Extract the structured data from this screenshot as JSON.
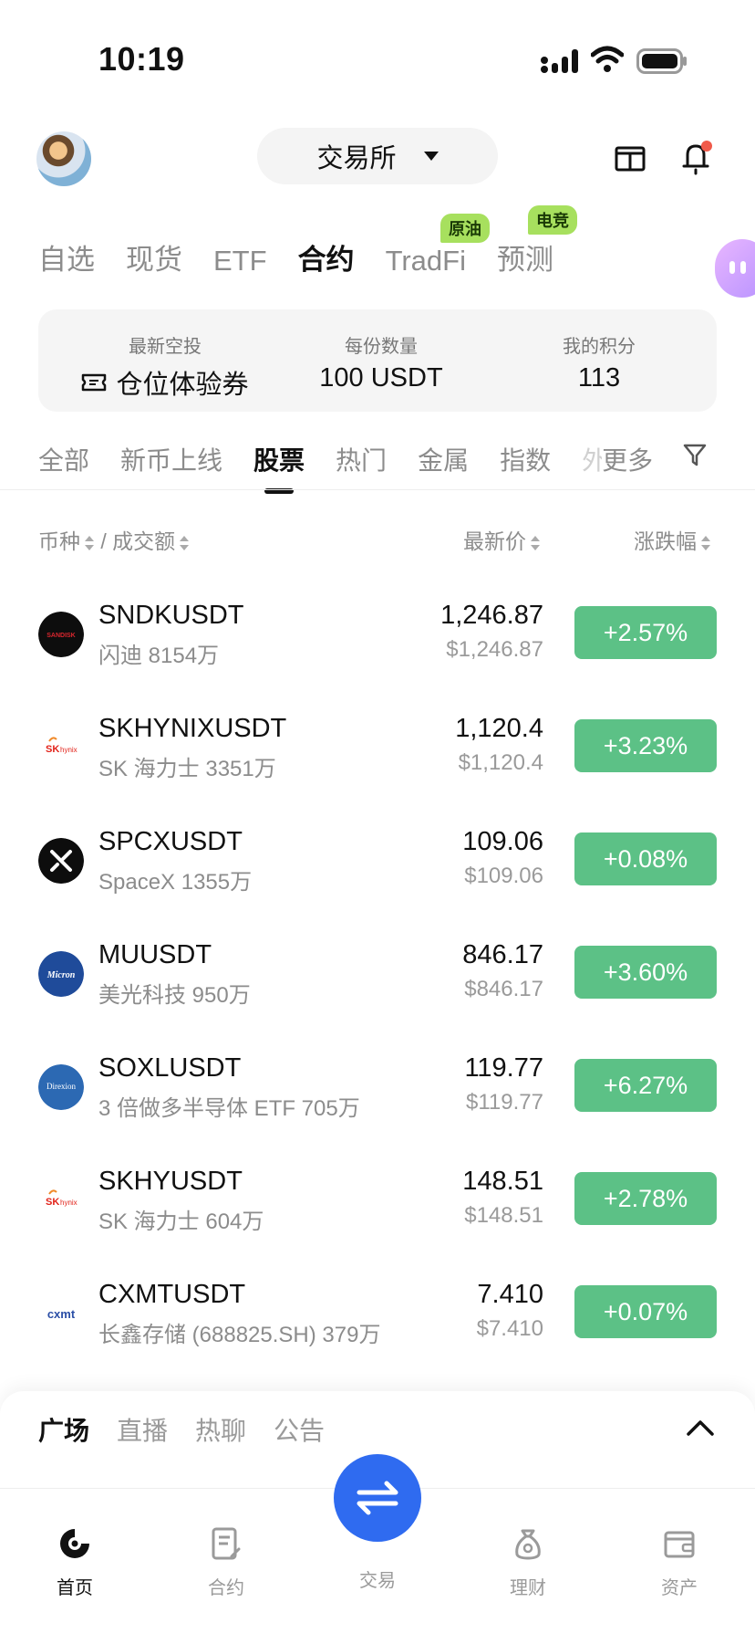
{
  "status_bar": {
    "time": "10:19"
  },
  "header": {
    "exchange_label": "交易所"
  },
  "category_tabs": [
    {
      "label": "自选",
      "active": false,
      "badge": ""
    },
    {
      "label": "现货",
      "active": false,
      "badge": ""
    },
    {
      "label": "ETF",
      "active": false,
      "badge": ""
    },
    {
      "label": "合约",
      "active": true,
      "badge": ""
    },
    {
      "label": "TradFi",
      "active": false,
      "badge": "原油"
    },
    {
      "label": "预测",
      "active": false,
      "badge": "电竞"
    }
  ],
  "airdrop": {
    "latest_label": "最新空投",
    "latest_value": "仓位体验券",
    "amount_label": "每份数量",
    "amount_value": "100 USDT",
    "points_label": "我的积分",
    "points_value": "113"
  },
  "sub_tabs": [
    {
      "label": "全部",
      "active": false
    },
    {
      "label": "新币上线",
      "active": false
    },
    {
      "label": "股票",
      "active": true
    },
    {
      "label": "热门",
      "active": false
    },
    {
      "label": "金属",
      "active": false
    },
    {
      "label": "指数",
      "active": false
    },
    {
      "label": "外",
      "active": false
    },
    {
      "label": "更多",
      "active": false
    }
  ],
  "list_header": {
    "coin": "币种",
    "separator": "/",
    "volume": "成交额",
    "price": "最新价",
    "change": "涨跌幅"
  },
  "rows": [
    {
      "symbol": "SNDKUSDT",
      "name": "闪迪 8154万",
      "price": "1,246.87",
      "price_usd": "$1,246.87",
      "change": "+2.57%",
      "logo": "sandisk-logo"
    },
    {
      "symbol": "SKHYNIXUSDT",
      "name": "SK 海力士 3351万",
      "price": "1,120.4",
      "price_usd": "$1,120.4",
      "change": "+3.23%",
      "logo": "skhynix-logo"
    },
    {
      "symbol": "SPCXUSDT",
      "name": "SpaceX 1355万",
      "price": "109.06",
      "price_usd": "$109.06",
      "change": "+0.08%",
      "logo": "spacex-logo"
    },
    {
      "symbol": "MUUSDT",
      "name": "美光科技 950万",
      "price": "846.17",
      "price_usd": "$846.17",
      "change": "+3.60%",
      "logo": "micron-logo"
    },
    {
      "symbol": "SOXLUSDT",
      "name": "3 倍做多半导体 ETF 705万",
      "price": "119.77",
      "price_usd": "$119.77",
      "change": "+6.27%",
      "logo": "direxion-logo"
    },
    {
      "symbol": "SKHYUSDT",
      "name": "SK 海力士 604万",
      "price": "148.51",
      "price_usd": "$148.51",
      "change": "+2.78%",
      "logo": "skhynix-logo"
    },
    {
      "symbol": "CXMTUSDT",
      "name": "长鑫存储 (688825.SH) 379万",
      "price": "7.410",
      "price_usd": "$7.410",
      "change": "+0.07%",
      "logo": "cxmt-logo"
    }
  ],
  "logo_text": {
    "sandisk": "SANDISK",
    "skhynix_sk": "SK",
    "skhynix_word": "hynix",
    "micron": "Micron",
    "direxion": "Direxion",
    "cxmt": "cxmt"
  },
  "square_tabs": [
    {
      "label": "广场",
      "active": true
    },
    {
      "label": "直播",
      "active": false
    },
    {
      "label": "热聊",
      "active": false
    },
    {
      "label": "公告",
      "active": false
    }
  ],
  "bottom_nav": {
    "home": "首页",
    "futures": "合约",
    "trade": "交易",
    "earn": "理财",
    "assets": "资产"
  },
  "colors": {
    "up_green": "#5cc186",
    "trade_blue": "#2f6bf0",
    "badge_green": "#a7e05e"
  }
}
